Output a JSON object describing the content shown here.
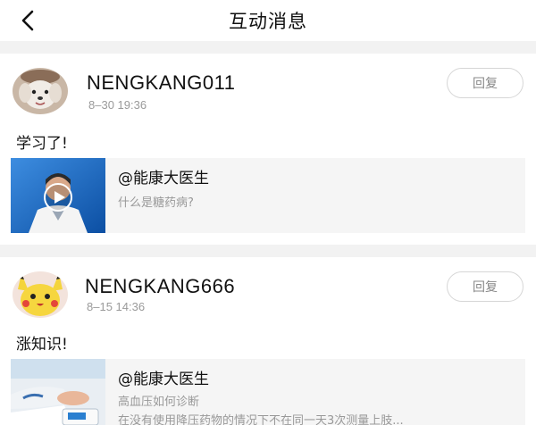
{
  "header": {
    "title": "互动消息",
    "back_icon": "back-arrow-icon"
  },
  "messages": [
    {
      "username": "NENGKANG011",
      "time": "8–30 19:36",
      "reply_label": "回复",
      "comment": "学习了!",
      "quote": {
        "author": "@能康大医生",
        "text": "什么是糖药病?",
        "text2": ""
      },
      "avatar_icon": "puppy-avatar-icon"
    },
    {
      "username": "NENGKANG666",
      "time": "8–15 14:36",
      "reply_label": "回复",
      "comment": "涨知识!",
      "quote": {
        "author": "@能康大医生",
        "text": "高血压如何诊断",
        "text2": "在没有使用降压药物的情况下不在同一天3次测量上肢..."
      },
      "avatar_icon": "pikachu-avatar-icon"
    }
  ]
}
